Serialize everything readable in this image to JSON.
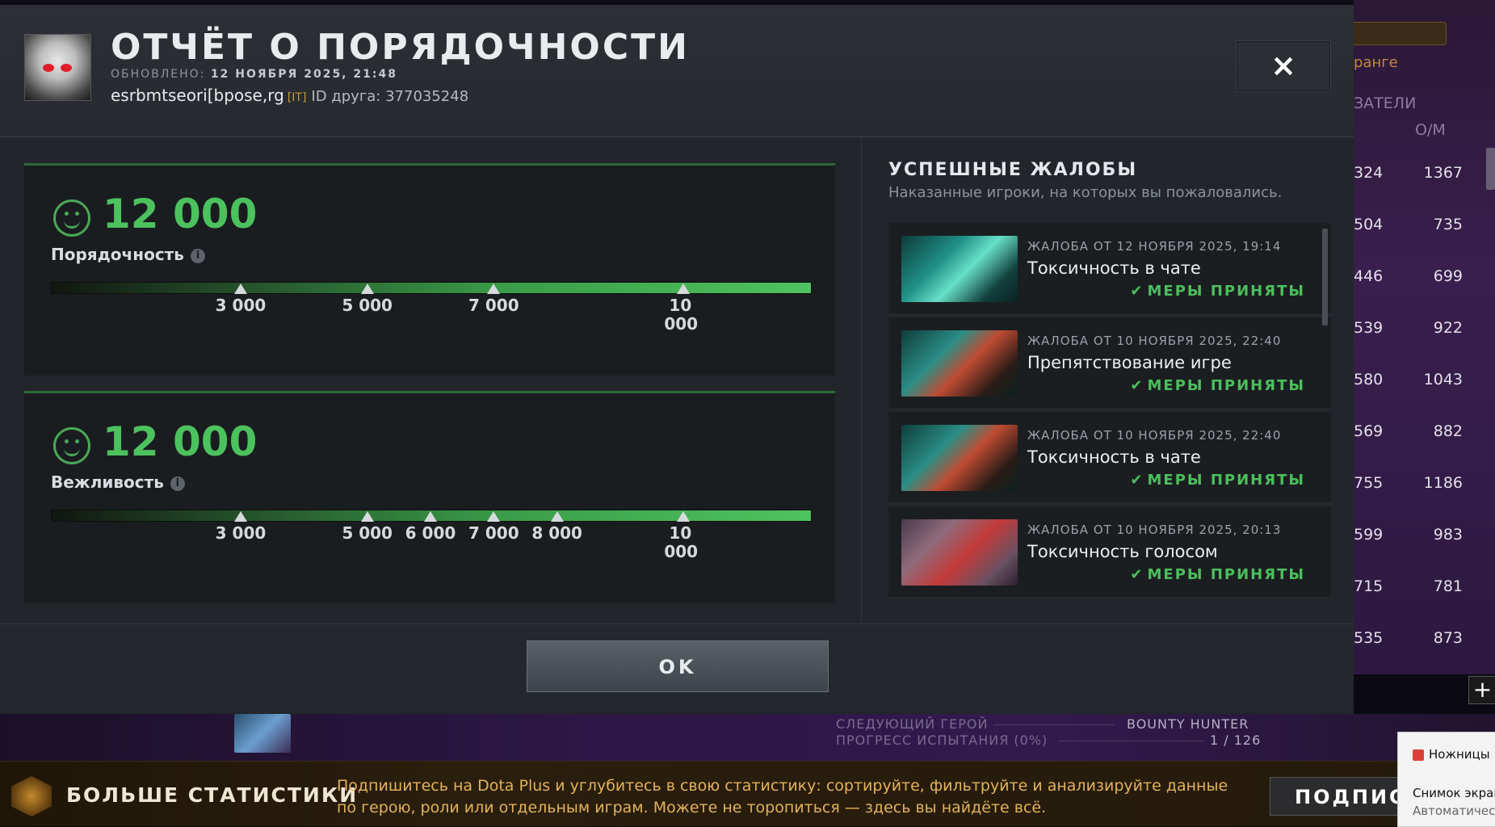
{
  "modal": {
    "title": "ОТЧЁТ О ПОРЯДОЧНОСТИ",
    "updated_label": "ОБНОВЛЕНО:",
    "updated_value": "12 НОЯБРЯ 2025, 21:48",
    "player_name": "esrbmtseori[bpose,rg",
    "player_tag": "[IT]",
    "friend_id": "ID друга: 377035248",
    "close_symbol": "×",
    "ok_label": "OK"
  },
  "conduct": [
    {
      "score": "12 000",
      "label": "Порядочность",
      "level": 1.0,
      "ticks": [
        {
          "label": "3 000",
          "value": 3000
        },
        {
          "label": "5 000",
          "value": 5000
        },
        {
          "label": "7 000",
          "value": 7000
        },
        {
          "label": "10 000",
          "value": 10000
        }
      ]
    },
    {
      "score": "12 000",
      "label": "Вежливость",
      "level": 1.0,
      "ticks": [
        {
          "label": "3 000",
          "value": 3000
        },
        {
          "label": "5 000",
          "value": 5000
        },
        {
          "label": "6 000",
          "value": 6000
        },
        {
          "label": "7 000",
          "value": 7000
        },
        {
          "label": "8 000",
          "value": 8000
        },
        {
          "label": "10 000",
          "value": 10000
        }
      ]
    }
  ],
  "reports": {
    "title": "УСПЕШНЫЕ ЖАЛОБЫ",
    "subtitle": "Наказанные игроки, на которых вы пожаловались.",
    "items": [
      {
        "date": "ЖАЛОБА ОТ 12 НОЯБРЯ 2025, 19:14",
        "reason": "Токсичность в чате",
        "status": "МЕРЫ ПРИНЯТЫ",
        "hero_icon": "hero-portrait-teal"
      },
      {
        "date": "ЖАЛОБА ОТ 10 НОЯБРЯ 2025, 22:40",
        "reason": "Препятствование игре",
        "status": "МЕРЫ ПРИНЯТЫ",
        "hero_icon": "hero-portrait-weaver"
      },
      {
        "date": "ЖАЛОБА ОТ 10 НОЯБРЯ 2025, 22:40",
        "reason": "Токсичность в чате",
        "status": "МЕРЫ ПРИНЯТЫ",
        "hero_icon": "hero-portrait-weaver"
      },
      {
        "date": "ЖАЛОБА ОТ 10 НОЯБРЯ 2025, 20:13",
        "reason": "Токсичность голосом",
        "status": "МЕРЫ ПРИНЯТЫ",
        "hero_icon": "hero-portrait-broodmother"
      }
    ]
  },
  "background": {
    "rank_text": "ранге",
    "col_head_1": "ЗАТЕЛИ",
    "col_head_2": "O/M",
    "rows": [
      {
        "c1": "324",
        "c2": "1367"
      },
      {
        "c1": "504",
        "c2": "735"
      },
      {
        "c1": "446",
        "c2": "699"
      },
      {
        "c1": "539",
        "c2": "922"
      },
      {
        "c1": "580",
        "c2": "1043"
      },
      {
        "c1": "569",
        "c2": "882"
      },
      {
        "c1": "755",
        "c2": "1186"
      },
      {
        "c1": "599",
        "c2": "983"
      },
      {
        "c1": "715",
        "c2": "781"
      },
      {
        "c1": "535",
        "c2": "873"
      }
    ],
    "plus": "+",
    "next_hero_label": "СЛЕДУЮЩИЙ ГЕРОЙ",
    "next_hero_value": "BOUNTY HUNTER",
    "challenge_label": "ПРОГРЕСС ИСПЫТАНИЯ (0%)",
    "challenge_value": "1 / 126"
  },
  "promo": {
    "title": "БОЛЬШЕ СТАТИСТИКИ",
    "text": "Подпишитесь на Dota Plus и углубитесь в свою статистику: сортируйте, фильтруйте и анализируйте данные по герою, роли или отдельным играм. Можете не торопиться — здесь вы найдёте всё.",
    "subscribe": "ПОДПИСАТЬСЯ"
  },
  "notification": {
    "app": "Ножницы",
    "line1": "Снимок экрана",
    "line2": "Автоматически"
  }
}
